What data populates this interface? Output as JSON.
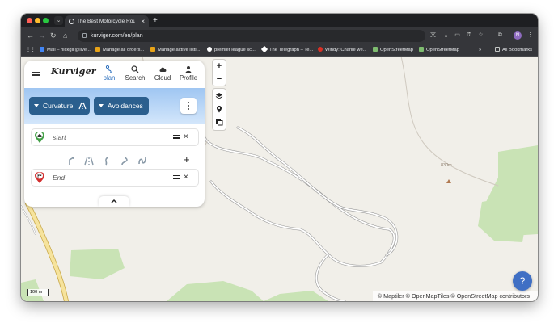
{
  "browser": {
    "tab_title": "The Best Motorcycle Route P",
    "tab_close": "×",
    "new_tab": "+",
    "url": "kurviger.com/en/plan",
    "profile_initial": "N",
    "bookmarks": [
      {
        "label": "Mail – nickgill@live....",
        "color": "#4285f4"
      },
      {
        "label": "Manage all orders...",
        "color": "#e8a317"
      },
      {
        "label": "Manage active listi...",
        "color": "#e8a317"
      },
      {
        "label": "premier league sc...",
        "color": "#ffffff"
      },
      {
        "label": "The Telegraph – Te...",
        "color": "#ffffff"
      },
      {
        "label": "Windy: Charlie we...",
        "color": "#d93025"
      },
      {
        "label": "OpenStreetMap",
        "color": "#7ebc6f"
      },
      {
        "label": "OpenStreetMap",
        "color": "#7ebc6f"
      }
    ],
    "bookmarks_overflow": "»",
    "all_bookmarks": "All Bookmarks"
  },
  "app": {
    "logo": "Kurviger",
    "nav": [
      {
        "label": "plan",
        "icon": "route-icon",
        "active": true
      },
      {
        "label": "Search",
        "icon": "search-icon",
        "active": false
      },
      {
        "label": "Cloud",
        "icon": "cloud-icon",
        "active": false
      },
      {
        "label": "Profile",
        "icon": "person-icon",
        "active": false
      }
    ],
    "curvature_label": "Curvature",
    "avoidances_label": "Avoidances",
    "start_placeholder": "start",
    "end_placeholder": "End",
    "add_waypoint": "+",
    "remove": "×"
  },
  "map": {
    "zoom_in": "+",
    "zoom_out": "−",
    "peak_label": "830m",
    "scale_label": "100 m",
    "attribution": "© Maptiler © OpenMapTiles © OpenStreetMap contributors",
    "help": "?",
    "colors": {
      "land": "#f1efe9",
      "green": "#c9e3b5",
      "road": "#ffffff",
      "road_casing": "#9a9a9a",
      "major_road": "#f6e39c",
      "accent": "#2b5f8e"
    }
  }
}
